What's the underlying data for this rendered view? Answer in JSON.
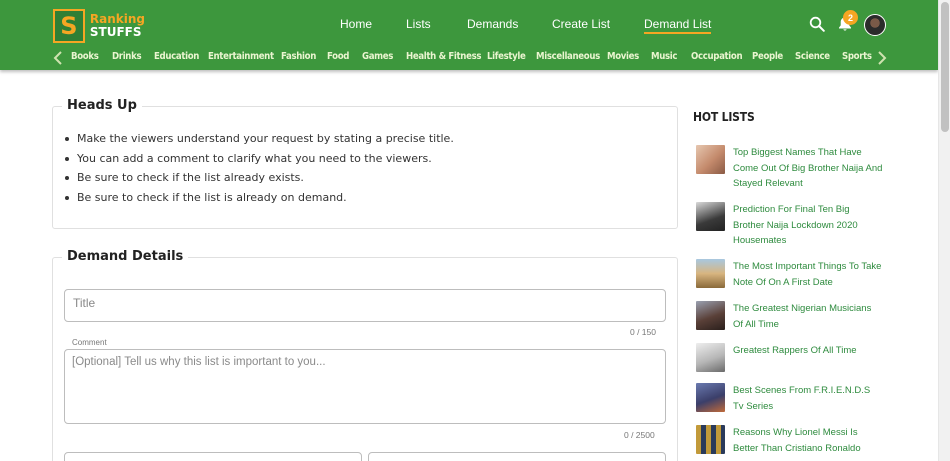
{
  "brand": {
    "line1": "Ranking",
    "line2": "STUFFS",
    "mark": "S",
    "accent_color": "#f5a623",
    "header_color": "#3d973d"
  },
  "nav": {
    "links": [
      "Home",
      "Lists",
      "Demands",
      "Create List",
      "Demand List"
    ],
    "active": "Demand List",
    "notifications_count": "2"
  },
  "categories": [
    "Books",
    "Drinks",
    "Education",
    "Entertainment",
    "Fashion",
    "Food",
    "Games",
    "Health & Fitness",
    "Lifestyle",
    "Miscellaneous",
    "Movies",
    "Music",
    "Occupation",
    "People",
    "Science",
    "Sports"
  ],
  "heads_up": {
    "title": "Heads Up",
    "tips": [
      "Make the viewers understand your request by stating a precise title.",
      "You can add a comment to clarify what you need to the viewers.",
      "Be sure to check if the list already exists.",
      "Be sure to check if the list is already on demand."
    ]
  },
  "demand_details": {
    "title": "Demand Details",
    "title_placeholder": "Title",
    "title_counter": "0 / 150",
    "comment_label": "Comment",
    "comment_placeholder": "[Optional] Tell us why this list is important to you...",
    "comment_counter": "0 / 2500"
  },
  "hot_lists": {
    "title": "HOT LISTS",
    "items": [
      {
        "text": "Top Biggest Names That Have Come Out Of Big Brother Naija And Stayed Relevant",
        "thumb_color": "#c48a6c"
      },
      {
        "text": "Prediction For Final Ten Big Brother Naija Lockdown 2020 Housemates",
        "thumb_color": "#3a3a3a"
      },
      {
        "text": "The Most Important Things To Take Note Of On A First Date",
        "thumb_color": "#c9a36a"
      },
      {
        "text": "The Greatest Nigerian Musicians Of All Time",
        "thumb_color": "#5a4038"
      },
      {
        "text": "Greatest Rappers Of All Time",
        "thumb_color": "#b7b7b7"
      },
      {
        "text": "Best Scenes From F.R.I.E.N.D.S Tv Series",
        "thumb_color": "#3b3f6a"
      },
      {
        "text": "Reasons Why Lionel Messi Is Better Than Cristiano Ronaldo",
        "thumb_color": "#c29a3a"
      }
    ]
  }
}
